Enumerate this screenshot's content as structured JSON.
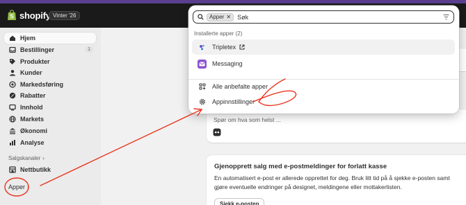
{
  "topbar": {
    "brand": "shopify",
    "edition": "Vinter '26"
  },
  "sidebar": {
    "items": [
      {
        "label": "Hjem",
        "icon": "home-icon"
      },
      {
        "label": "Bestillinger",
        "icon": "inbox-icon",
        "count": "1"
      },
      {
        "label": "Produkter",
        "icon": "tag-icon"
      },
      {
        "label": "Kunder",
        "icon": "person-icon"
      },
      {
        "label": "Markedsføring",
        "icon": "target-icon"
      },
      {
        "label": "Rabatter",
        "icon": "discount-icon"
      },
      {
        "label": "Innhold",
        "icon": "content-icon"
      },
      {
        "label": "Markets",
        "icon": "globe-icon"
      },
      {
        "label": "Økonomi",
        "icon": "bank-icon"
      },
      {
        "label": "Analyse",
        "icon": "chart-icon"
      }
    ],
    "sales_channels_label": "Salgskanaler",
    "online_store": "Nettbutikk",
    "apps_label": "Apper"
  },
  "search": {
    "chip": "Apper",
    "query": "Søk",
    "group_label": "Installerte apper (2)",
    "results": [
      {
        "label": "Tripletex",
        "icon": "tripletex-icon"
      },
      {
        "label": "Messaging",
        "icon": "messaging-icon"
      }
    ],
    "links": [
      {
        "label": "Alle anbefalte apper",
        "icon": "apps-grid-icon"
      },
      {
        "label": "Appinnstillinger",
        "icon": "gear-icon"
      }
    ]
  },
  "main": {
    "card_peek": "ver",
    "ask_placeholder": "Spør om hva som helst ...",
    "promo": {
      "title": "Gjenopprett salg med e-postmeldinger for forlatt kasse",
      "body": "En automatisert e-post er allerede opprettet for deg. Bruk litt tid på å sjekke e-posten samt gjøre eventuelle endringer på designet, meldingene eller mottakerlisten.",
      "button": "Sjekk e-posten"
    }
  },
  "colors": {
    "topbar": "#1a1a1a",
    "accent_strip": "#5b3f8f",
    "annotation": "#e8341c"
  }
}
